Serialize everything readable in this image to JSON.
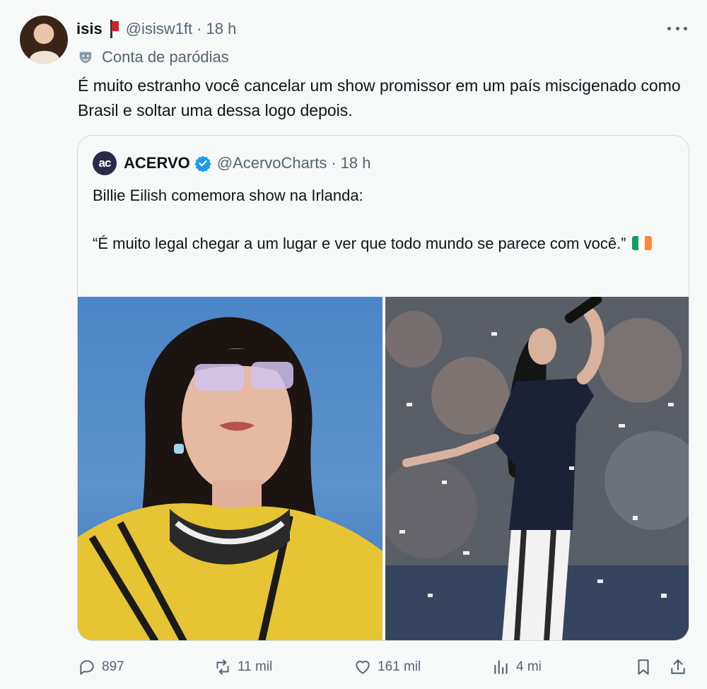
{
  "author": {
    "name": "isis",
    "handle": "@isisw1ft",
    "time": "18 h",
    "label": "Conta de paródias"
  },
  "tweet": {
    "text": "É muito estranho você cancelar um show promissor em um país miscigenado como Brasil e soltar uma dessa logo depois."
  },
  "quoted": {
    "avatar_text": "ac",
    "name": "ACERVO",
    "handle": "@AcervoCharts",
    "time": "18 h",
    "line1": "Billie Eilish comemora show na Irlanda:",
    "line2": "“É muito legal chegar a um lugar e ver que todo mundo se parece com você.”",
    "flag_colors": [
      "#169b62",
      "#ffffff",
      "#ff883e"
    ]
  },
  "actions": {
    "replies": "897",
    "retweets": "11 mil",
    "likes": "161 mil",
    "views": "4 mi"
  },
  "colors": {
    "background": "#f7f9f9",
    "secondary_text": "#536471",
    "verified": "#1d9bf0"
  }
}
